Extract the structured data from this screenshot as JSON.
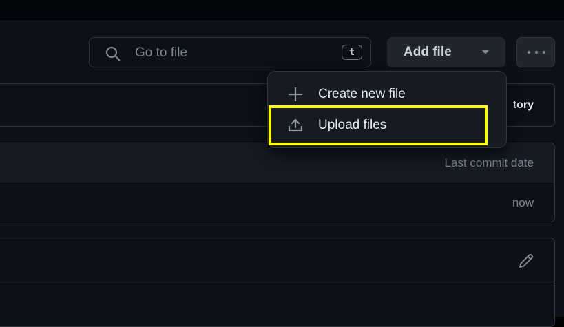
{
  "search": {
    "placeholder": "Go to file",
    "shortcut": "t"
  },
  "toolbar": {
    "add_file_label": "Add file"
  },
  "history": {
    "label_fragment": "tory"
  },
  "file_table": {
    "header_last_commit_date": "Last commit date",
    "rows": [
      {
        "date": "now"
      }
    ]
  },
  "add_file_menu": {
    "items": [
      {
        "label": "Create new file",
        "icon": "plus-icon"
      },
      {
        "label": "Upload files",
        "icon": "upload-icon"
      }
    ]
  },
  "colors": {
    "background": "#0d1117",
    "border": "#30363d",
    "button": "#21262d",
    "highlight": "#ffff00",
    "muted_text": "#7d8590"
  }
}
